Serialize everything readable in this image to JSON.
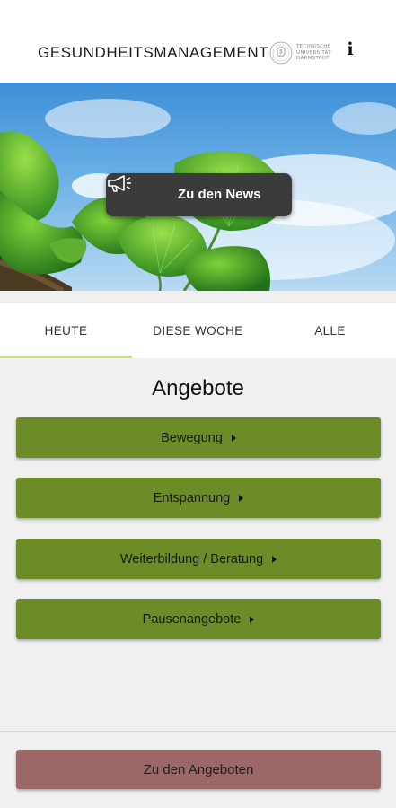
{
  "header": {
    "title": "GESUNDHEITSMANAGEMENT",
    "logo_lines": [
      "TECHNISCHE",
      "UNIVERSITÄT",
      "DARMSTADT"
    ],
    "logo_icon": "tu-darmstadt-seal",
    "info_icon": "info-icon",
    "info_glyph": "i"
  },
  "hero": {
    "image": "ginkgo-leaves-against-sky",
    "news_button": {
      "label": "Zu den News",
      "icon": "megaphone-icon"
    }
  },
  "tabs": [
    {
      "label": "HEUTE",
      "active": true
    },
    {
      "label": "DIESE WOCHE",
      "active": false
    },
    {
      "label": "ALLE",
      "active": false
    }
  ],
  "main": {
    "title": "Angebote",
    "offers": [
      {
        "label": "Bewegung"
      },
      {
        "label": "Entspannung"
      },
      {
        "label": "Weiterbildung / Beratung"
      },
      {
        "label": "Pausenangebote"
      }
    ]
  },
  "footer": {
    "button_label": "Zu den Angeboten"
  },
  "colors": {
    "offer_button": "#6b8c26",
    "footer_button": "#9b6767",
    "news_button": "#3b3b3b",
    "tab_indicator": "#c9dd9a",
    "background": "#f0f0f0"
  }
}
